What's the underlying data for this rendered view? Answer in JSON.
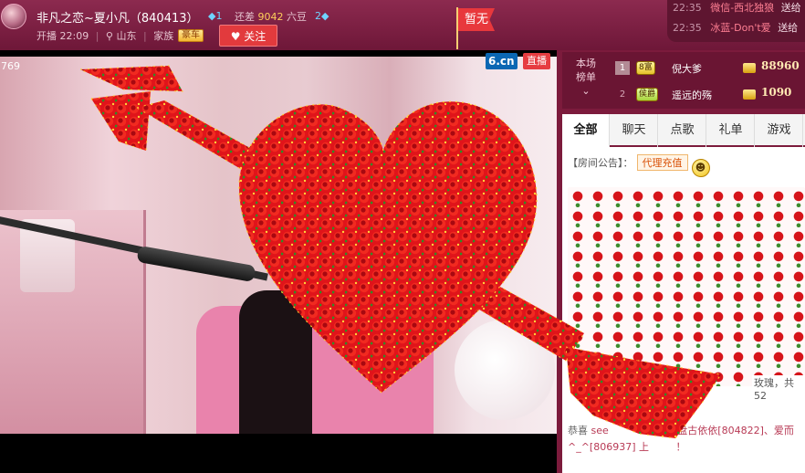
{
  "header": {
    "anchor_name": "非凡之恋~夏小凡（840413）",
    "diamond_level_1": "1",
    "short_label_prefix": "还差",
    "short_amount": "9042",
    "short_unit": "六豆",
    "diamond_level_2": "2",
    "start_label": "开播 22:09",
    "location": "山东",
    "family_label": "家族",
    "family_badge": "豪车",
    "follow_label": "关注",
    "flag_label": "暂无"
  },
  "chat_ticker": [
    {
      "time": "22:35",
      "user": "微信-西北独狼",
      "action": "送给"
    },
    {
      "time": "22:35",
      "user": "冰蓝-Don't爱",
      "action": "送给"
    }
  ],
  "video": {
    "viewer_count": "769",
    "site_logo": "6.cn",
    "live_badge": "直播"
  },
  "ranking": {
    "label_line1": "本场",
    "label_line2": "榜单",
    "rows": [
      {
        "rank": "1",
        "medal": "8富",
        "name": "倪大爹",
        "score": "88960"
      },
      {
        "rank": "2",
        "medal": "侯爵",
        "name": "遥远的殇",
        "score": "1090"
      }
    ]
  },
  "tabs": [
    "全部",
    "聊天",
    "点歌",
    "礼单",
    "游戏"
  ],
  "notice": {
    "label": "【房间公告】：",
    "tag": "代理充值"
  },
  "gift": {
    "caption": "玫瑰，共52"
  },
  "gift_notice": {
    "prefix": "恭喜",
    "names": "see",
    "tail1": "盘古依依[804822]、爱而",
    "line2": "^_^[806937] 上",
    "end": "！"
  },
  "colors": {
    "accent": "#7c1b3c",
    "follow_button": "#e23a3d",
    "rose": "#d6141a"
  }
}
